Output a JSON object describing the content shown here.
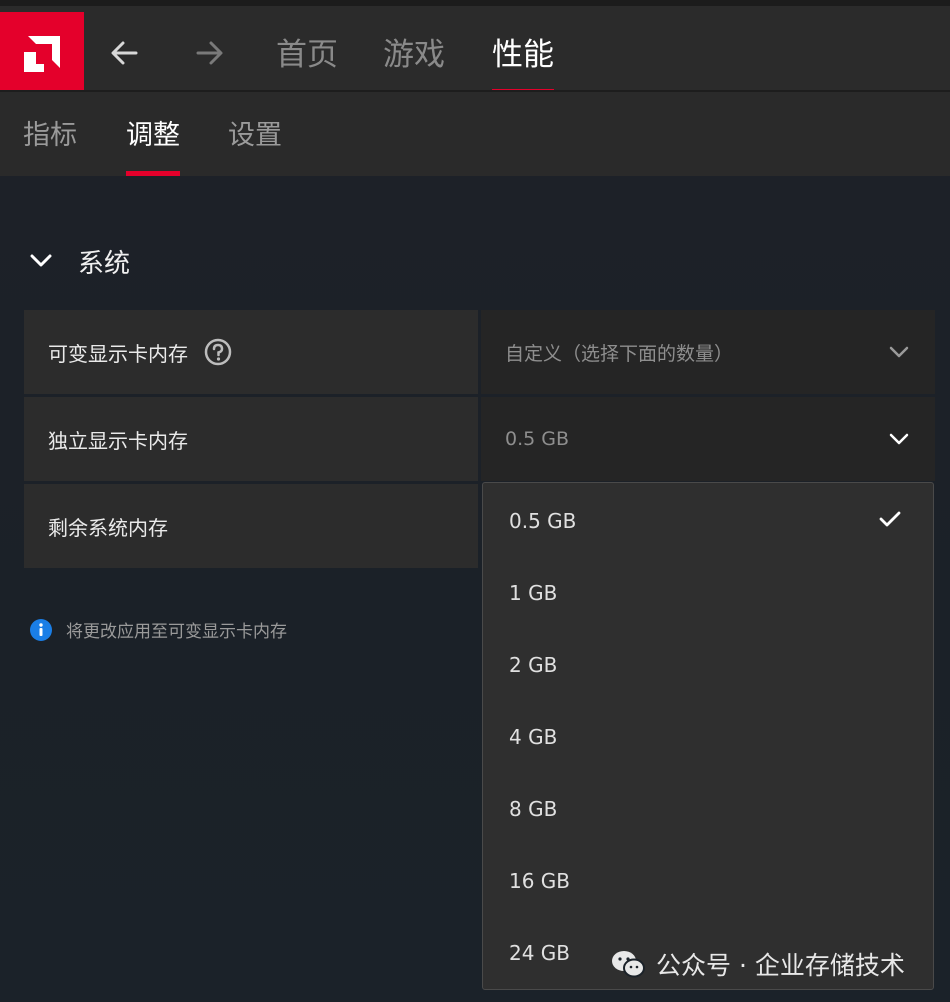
{
  "top_nav": {
    "tabs": [
      {
        "label": "首页"
      },
      {
        "label": "游戏"
      },
      {
        "label": "性能",
        "active": true
      }
    ]
  },
  "sub_nav": {
    "tabs": [
      {
        "label": "指标"
      },
      {
        "label": "调整",
        "active": true
      },
      {
        "label": "设置"
      }
    ]
  },
  "section": {
    "title": "系统"
  },
  "rows": [
    {
      "label": "可变显示卡内存",
      "value": "自定义（选择下面的数量）",
      "has_help": true
    },
    {
      "label": "独立显示卡内存",
      "value": "0.5 GB"
    },
    {
      "label": "剩余系统内存"
    }
  ],
  "info": {
    "text": "将更改应用至可变显示卡内存"
  },
  "dropdown": {
    "selected": "0.5 GB",
    "options": [
      "0.5 GB",
      "1 GB",
      "2 GB",
      "4 GB",
      "8 GB",
      "16 GB",
      "24 GB"
    ]
  },
  "watermark": {
    "text": "公众号 · 企业存储技术"
  },
  "colors": {
    "accent": "#e4002b",
    "info": "#1a7ee6"
  },
  "icons": [
    "amd-logo-icon",
    "back-arrow-icon",
    "forward-arrow-icon",
    "chevron-down-icon",
    "help-icon",
    "info-icon",
    "check-icon",
    "wechat-icon"
  ]
}
